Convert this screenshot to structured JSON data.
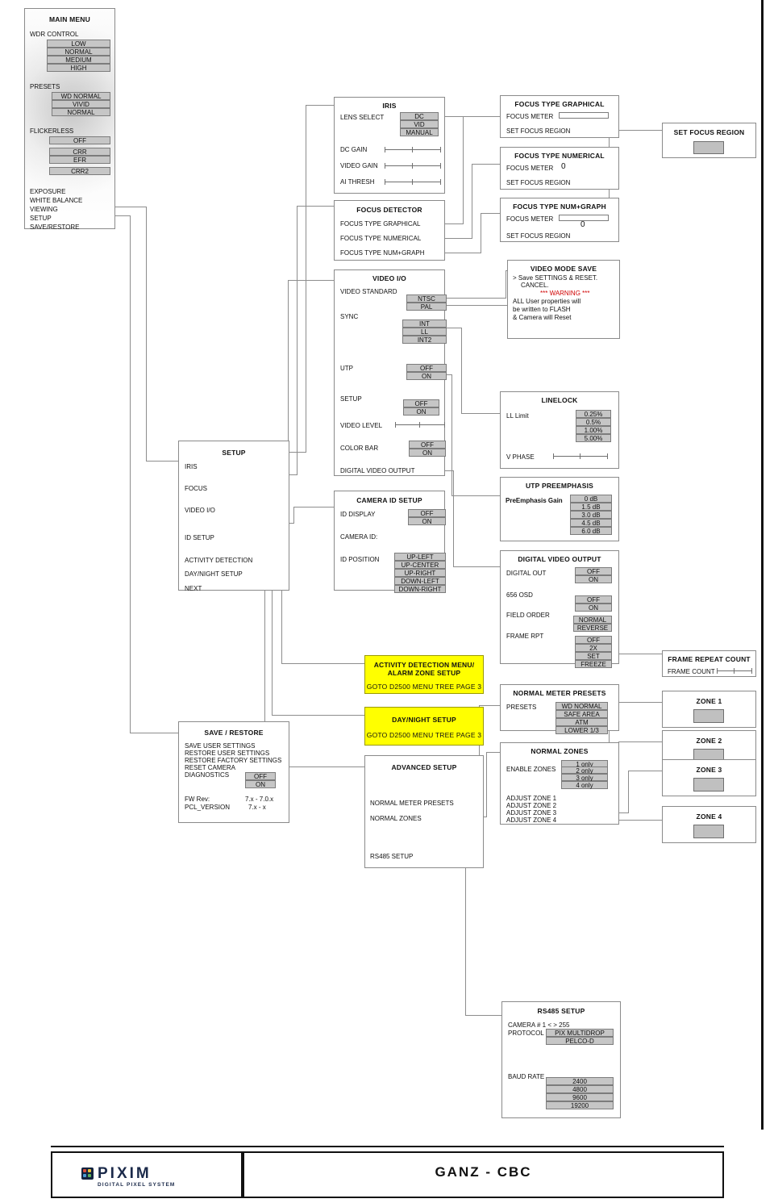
{
  "main_menu": {
    "title": "MAIN MENU",
    "wdr_control": {
      "label": "WDR CONTROL",
      "options": [
        "LOW",
        "NORMAL",
        "MEDIUM",
        "HIGH"
      ]
    },
    "presets": {
      "label": "PRESETS",
      "options": [
        "WD NORMAL",
        "VIVID",
        "NORMAL"
      ]
    },
    "flickerless": {
      "label": "FLICKERLESS",
      "options": [
        "OFF",
        "CRR",
        "EFR",
        "CRR2"
      ]
    },
    "items": [
      "EXPOSURE",
      "WHITE BALANCE",
      "VIEWING",
      "SETUP",
      "SAVE/RESTORE"
    ]
  },
  "iris": {
    "title": "IRIS",
    "lens_select_label": "LENS SELECT",
    "lens_select_options": [
      "DC",
      "VID",
      "MANUAL"
    ],
    "dc_gain_label": "DC GAIN",
    "video_gain_label": "VIDEO GAIN",
    "ai_thresh_label": "AI THRESH"
  },
  "focus_detector": {
    "title": "FOCUS DETECTOR",
    "items": [
      "FOCUS TYPE GRAPHICAL",
      "FOCUS TYPE NUMERICAL",
      "FOCUS TYPE NUM+GRAPH"
    ]
  },
  "focus_graphical": {
    "title": "FOCUS TYPE GRAPHICAL",
    "meter_label": "FOCUS METER",
    "region_label": "SET FOCUS REGION"
  },
  "focus_numerical": {
    "title": "FOCUS TYPE NUMERICAL",
    "meter_label": "FOCUS METER",
    "meter_value": "0",
    "region_label": "SET FOCUS REGION"
  },
  "focus_numgraph": {
    "title": "FOCUS TYPE NUM+GRAPH",
    "meter_label": "FOCUS METER",
    "meter_value": "0",
    "region_label": "SET FOCUS REGION"
  },
  "set_focus_region": {
    "title": "SET FOCUS REGION"
  },
  "video_io": {
    "title": "VIDEO I/O",
    "video_standard_label": "VIDEO STANDARD",
    "video_standard_options": [
      "NTSC",
      "PAL"
    ],
    "sync_label": "SYNC",
    "sync_options": [
      "INT",
      "LL",
      "INT2"
    ],
    "utp_label": "UTP",
    "utp_options": [
      "OFF",
      "ON"
    ],
    "setup_label": "SETUP",
    "setup_options": [
      "OFF",
      "ON"
    ],
    "video_level_label": "VIDEO LEVEL",
    "color_bar_label": "COLOR BAR",
    "color_bar_options": [
      "OFF",
      "ON"
    ],
    "digital_video_output_label": "DIGITAL VIDEO OUTPUT"
  },
  "video_mode_save": {
    "title": "VIDEO MODE SAVE",
    "line1": "> Save SETTINGS & RESET.",
    "line2": "CANCEL.",
    "warning": "*** WARNING ***",
    "line3": "ALL User properties will",
    "line4": "be written to FLASH",
    "line5": "& Camera will Reset"
  },
  "linelock": {
    "title": "LINELOCK",
    "ll_limit_label": "LL Limit",
    "ll_limit_options": [
      "0.25%",
      "0.5%",
      "1.00%",
      "5.00%"
    ],
    "v_phase_label": "V PHASE"
  },
  "utp_preemphasis": {
    "title": "UTP PREEMPHASIS",
    "gain_label": "PreEmphasis Gain",
    "gain_options": [
      "0 dB",
      "1.5 dB",
      "3.0 dB",
      "4.5 dB",
      "6.0 dB"
    ]
  },
  "setup_menu": {
    "title": "SETUP",
    "items": [
      "IRIS",
      "FOCUS",
      "VIDEO I/O",
      "ID SETUP",
      "ACTIVITY DETECTION",
      "DAY/NIGHT SETUP",
      "NEXT"
    ]
  },
  "camera_id_setup": {
    "title": "CAMERA ID SETUP",
    "id_display_label": "ID DISPLAY",
    "id_display_options": [
      "OFF",
      "ON"
    ],
    "camera_id_label": "CAMERA ID:",
    "id_position_label": "ID POSITION",
    "id_position_options": [
      "UP-LEFT",
      "UP-CENTER",
      "UP-RIGHT",
      "DOWN-LEFT",
      "DOWN-RIGHT"
    ]
  },
  "digital_video_output": {
    "title": "DIGITAL VIDEO OUTPUT",
    "digital_out_label": "DIGITAL OUT",
    "digital_out_options": [
      "OFF",
      "ON"
    ],
    "osd_label": "656 OSD",
    "osd_options": [
      "OFF",
      "ON"
    ],
    "field_order_label": "FIELD ORDER",
    "field_order_options": [
      "NORMAL",
      "REVERSE"
    ],
    "frame_rpt_label": "FRAME RPT",
    "frame_rpt_options": [
      "OFF",
      "2X",
      "SET",
      "FREEZE"
    ]
  },
  "frame_repeat_count": {
    "title": "FRAME REPEAT COUNT",
    "frame_count_label": "FRAME COUNT"
  },
  "activity_detection": {
    "title_line1": "ACTIVITY DETECTION MENU/",
    "title_line2": "ALARM ZONE SETUP",
    "goto": "GOTO D2500 MENU TREE PAGE 3"
  },
  "day_night_setup": {
    "title": "DAY/NIGHT SETUP",
    "goto": "GOTO D2500 MENU TREE PAGE 3"
  },
  "advanced_setup": {
    "title": "ADVANCED SETUP",
    "items": [
      "NORMAL METER PRESETS",
      "NORMAL ZONES",
      "RS485 SETUP"
    ]
  },
  "save_restore": {
    "title": "SAVE / RESTORE",
    "items": [
      "SAVE USER SETTINGS",
      "RESTORE USER SETTINGS",
      "RESTORE FACTORY  SETTINGS",
      "RESET CAMERA",
      "DIAGNOSTICS"
    ],
    "diagnostics_options": [
      "OFF",
      "ON"
    ],
    "fw_rev_label": "FW Rev:",
    "fw_rev_value": "7.x  - 7.0.x",
    "pcl_version_label": "PCL_VERSION",
    "pcl_version_value": "7.x  - x"
  },
  "normal_meter_presets": {
    "title": "NORMAL METER PRESETS",
    "presets_label": "PRESETS",
    "presets_options": [
      "WD NORMAL",
      "SAFE AREA",
      "ATM",
      "LOWER 1/3"
    ]
  },
  "normal_zones": {
    "title": "NORMAL ZONES",
    "enable_label": "ENABLE ZONES",
    "enable_options": [
      "1 only",
      "2 only",
      "3 only",
      "4 only"
    ],
    "adjust_items": [
      "ADJUST ZONE 1",
      "ADJUST ZONE 2",
      "ADJUST ZONE 3",
      "ADJUST ZONE 4"
    ]
  },
  "zones": [
    {
      "title": "ZONE 1"
    },
    {
      "title": "ZONE 2"
    },
    {
      "title": "ZONE 3"
    },
    {
      "title": "ZONE 4"
    }
  ],
  "rs485_setup": {
    "title": "RS485 SETUP",
    "camera_num_label": "CAMERA # 1 < > 255",
    "protocol_label": "PROTOCOL",
    "protocol_options": [
      "PIX MULTIDROP",
      "PELCO-D"
    ],
    "baud_rate_label": "BAUD RATE",
    "baud_rate_options": [
      "2400",
      "4800",
      "9600",
      "19200"
    ]
  },
  "footer": {
    "brand": "GANZ  -  CBC",
    "logo_wordmark": "PIXIM",
    "logo_tagline": "DIGITAL PIXEL SYSTEM"
  },
  "colors": {
    "option_fill": "#c6c6c6",
    "highlight": "#ffff00",
    "warning": "#d00000",
    "line": "#8d8d8d"
  }
}
